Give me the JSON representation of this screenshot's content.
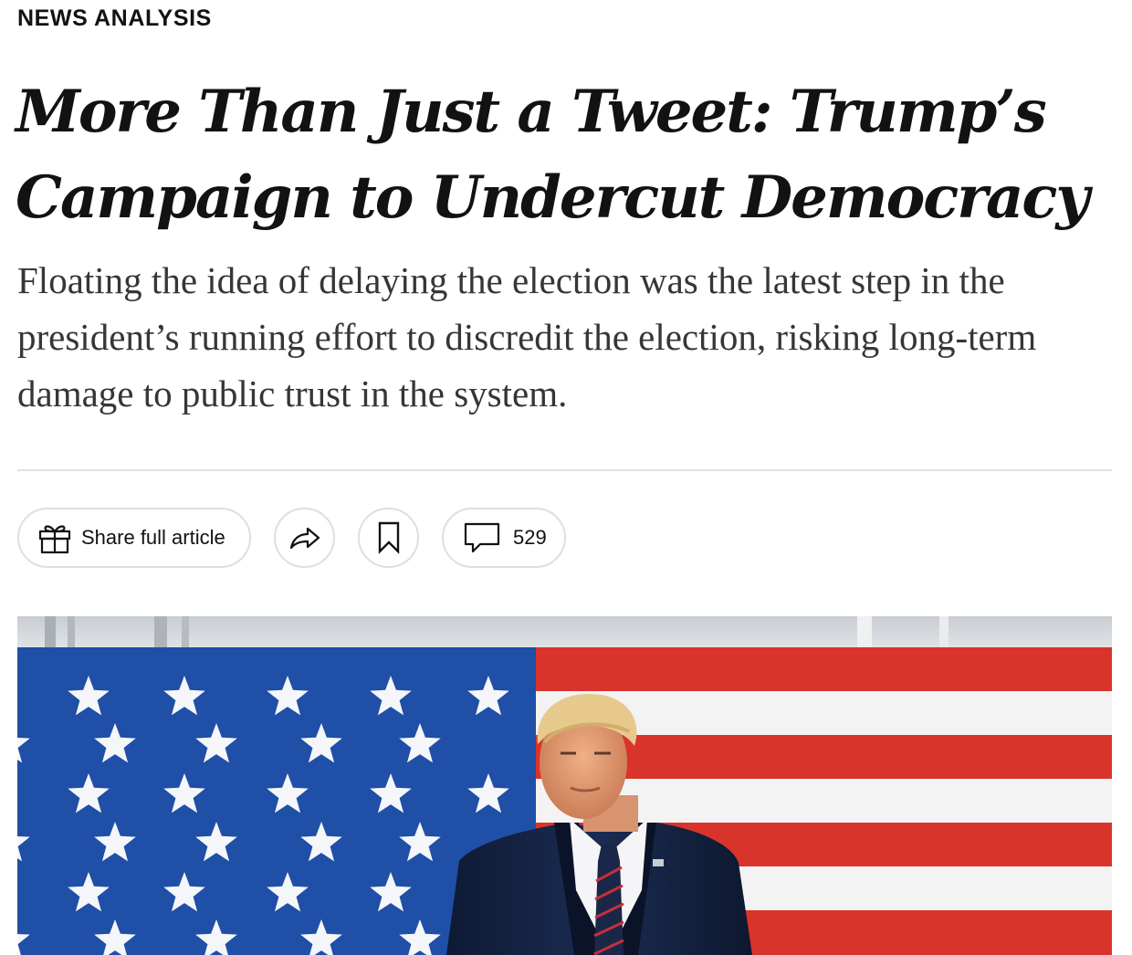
{
  "article": {
    "kicker": "NEWS ANALYSIS",
    "headline_line1": "More Than Just a Tweet: Trump’s",
    "headline_line2": "Campaign to Undercut Democracy",
    "summary": "Floating the idea of delaying the election was the latest step in the president’s running effort to discredit the election, risking long-term damage to public trust in the system."
  },
  "toolbar": {
    "share_label": "Share full article",
    "share_icon": "gift-icon",
    "forward_icon": "share-arrow-icon",
    "save_icon": "bookmark-icon",
    "comments_icon": "comment-bubble-icon",
    "comments_count": "529"
  },
  "colors": {
    "text": "#121212",
    "summary_text": "#363636",
    "pill_border": "#dfdfdf",
    "flag_blue": "#1f4fa6",
    "flag_red": "#d9342b"
  }
}
